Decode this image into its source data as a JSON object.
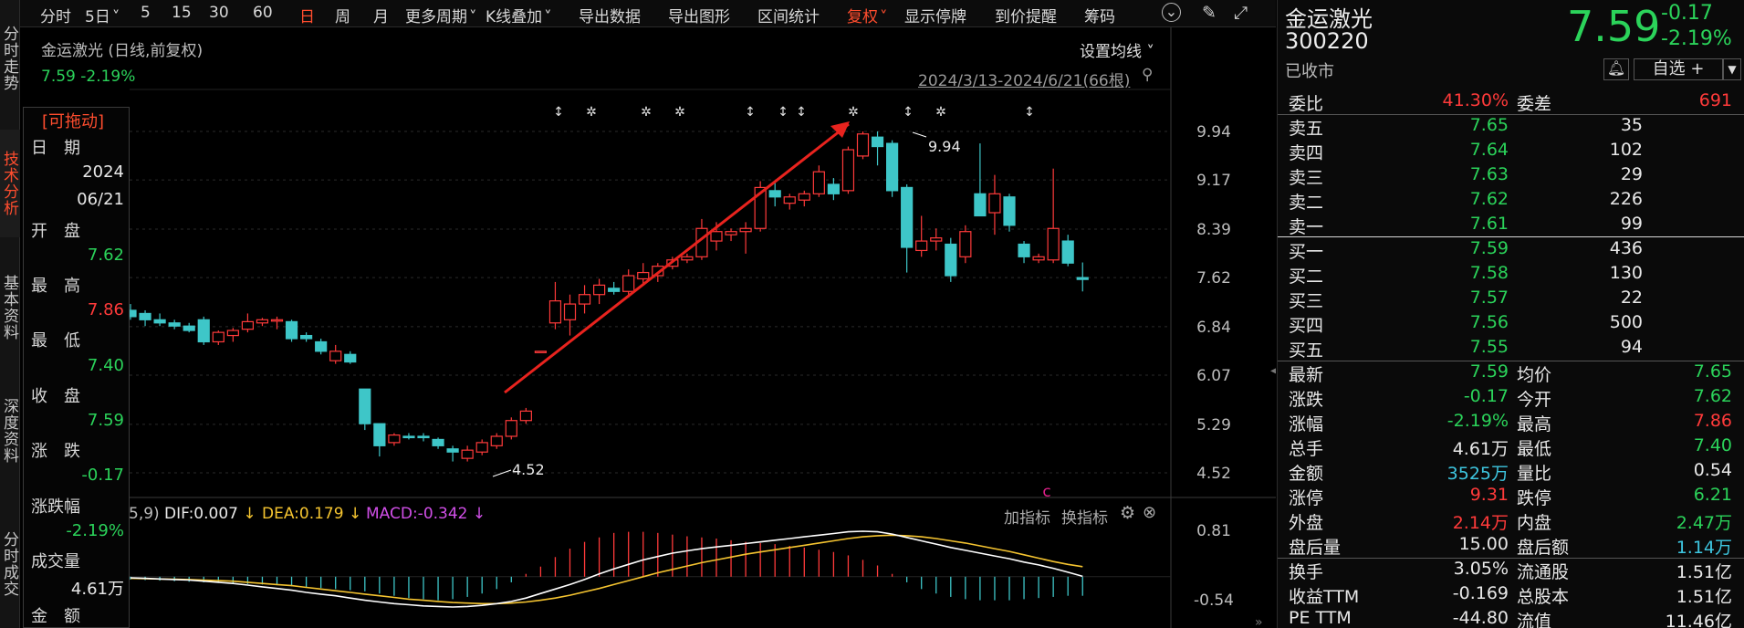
{
  "left_nav": [
    {
      "label": "分时走势",
      "active": false
    },
    {
      "label": "技术分析",
      "active": true
    },
    {
      "label": "基本资料",
      "active": false
    },
    {
      "label": "深度资料",
      "active": false
    },
    {
      "label": "分时成交",
      "active": false
    }
  ],
  "toolbar": {
    "items": [
      "分时",
      "5日",
      "5",
      "15",
      "30",
      "60",
      "日",
      "周",
      "月",
      "更多周期",
      "K线叠加",
      "导出数据",
      "导出图形",
      "区间统计",
      "复权",
      "显示停牌",
      "到价提醒",
      "筹码"
    ],
    "active": "日",
    "highlight": "复权"
  },
  "chart": {
    "title": "金运激光 (日线,前复权)",
    "price_change": "7.59 -2.19%",
    "ma_settings": "设置均线",
    "date_range": "2024/3/13-2024/6/21(66根)",
    "y_labels": [
      "9.94",
      "9.17",
      "8.39",
      "7.62",
      "6.84",
      "6.07",
      "5.29",
      "4.52"
    ],
    "high_label": "9.94",
    "low_label": "4.52",
    "marker": "c"
  },
  "info_panel": {
    "title": "[可拖动]",
    "rows": [
      {
        "label": "日　期",
        "value": ""
      },
      {
        "label": "",
        "value": "2024"
      },
      {
        "label": "",
        "value": "06/21"
      },
      {
        "label": "开　盘",
        "value": ""
      },
      {
        "label": "",
        "value": "7.62"
      },
      {
        "label": "最　高",
        "value": ""
      },
      {
        "label": "",
        "value": "7.86"
      },
      {
        "label": "最　低",
        "value": ""
      },
      {
        "label": "",
        "value": "7.40"
      },
      {
        "label": "收　盘",
        "value": ""
      },
      {
        "label": "",
        "value": "7.59"
      },
      {
        "label": "涨　跌",
        "value": ""
      },
      {
        "label": "",
        "value": "-0.17"
      },
      {
        "label": "涨跌幅",
        "value": ""
      },
      {
        "label": "",
        "value": "-2.19%"
      },
      {
        "label": "成交量",
        "value": ""
      },
      {
        "label": "",
        "value": "4.61万"
      },
      {
        "label": "金　额",
        "value": ""
      }
    ]
  },
  "macd": {
    "params": "5,9)",
    "dif": "DIF:0.007",
    "dea": "DEA:0.179",
    "macd": "MACD:-0.342",
    "add_indicator": "加指标",
    "switch_indicator": "换指标",
    "y_top": "0.81",
    "y_bottom": "-0.54"
  },
  "quote": {
    "name": "金运激光",
    "code": "300220",
    "status": "已收市",
    "price": "7.59",
    "change": "-0.17",
    "change_pct": "-2.19%",
    "watchlist_btn": "自选 +",
    "weibi_label": "委比",
    "weibi": "41.30%",
    "weicha_label": "委差",
    "weicha": "691",
    "asks": [
      {
        "label": "卖五",
        "price": "7.65",
        "vol": "35"
      },
      {
        "label": "卖四",
        "price": "7.64",
        "vol": "102"
      },
      {
        "label": "卖三",
        "price": "7.63",
        "vol": "29"
      },
      {
        "label": "卖二",
        "price": "7.62",
        "vol": "226"
      },
      {
        "label": "卖一",
        "price": "7.61",
        "vol": "99"
      }
    ],
    "bids": [
      {
        "label": "买一",
        "price": "7.59",
        "vol": "436"
      },
      {
        "label": "买二",
        "price": "7.58",
        "vol": "130"
      },
      {
        "label": "买三",
        "price": "7.57",
        "vol": "22"
      },
      {
        "label": "买四",
        "price": "7.56",
        "vol": "500"
      },
      {
        "label": "买五",
        "price": "7.55",
        "vol": "94"
      }
    ],
    "stats": [
      {
        "l1": "最新",
        "v1": "7.59",
        "c1": "green",
        "l2": "均价",
        "v2": "7.65",
        "c2": "green"
      },
      {
        "l1": "涨跌",
        "v1": "-0.17",
        "c1": "green",
        "l2": "今开",
        "v2": "7.62",
        "c2": "green"
      },
      {
        "l1": "涨幅",
        "v1": "-2.19%",
        "c1": "green",
        "l2": "最高",
        "v2": "7.86",
        "c2": "red"
      },
      {
        "l1": "总手",
        "v1": "4.61万",
        "c1": "white",
        "l2": "最低",
        "v2": "7.40",
        "c2": "green"
      },
      {
        "l1": "金额",
        "v1": "3525万",
        "c1": "cyan",
        "l2": "量比",
        "v2": "0.54",
        "c2": "white"
      },
      {
        "l1": "涨停",
        "v1": "9.31",
        "c1": "red",
        "l2": "跌停",
        "v2": "6.21",
        "c2": "green"
      },
      {
        "l1": "外盘",
        "v1": "2.14万",
        "c1": "red",
        "l2": "内盘",
        "v2": "2.47万",
        "c2": "green"
      },
      {
        "l1": "盘后量",
        "v1": "15.00",
        "c1": "white",
        "l2": "盘后额",
        "v2": "1.14万",
        "c2": "cyan"
      },
      {
        "l1": "换手",
        "v1": "3.05%",
        "c1": "white",
        "l2": "流通股",
        "v2": "1.51亿",
        "c2": "white"
      },
      {
        "l1": "收益TTM",
        "v1": "-0.169",
        "c1": "white",
        "l2": "总股本",
        "v2": "1.51亿",
        "c2": "white"
      },
      {
        "l1": "PE TTM",
        "v1": "-44.80",
        "c1": "white",
        "l2": "流值",
        "v2": "11.46亿",
        "c2": "white"
      }
    ]
  },
  "chart_data": {
    "type": "candlestick",
    "ylim": [
      4.52,
      9.94
    ],
    "candles": [
      [
        7.1,
        7.2,
        6.95,
        7.0
      ],
      [
        7.05,
        7.1,
        6.85,
        6.95
      ],
      [
        6.95,
        7.05,
        6.85,
        6.9
      ],
      [
        6.9,
        6.95,
        6.8,
        6.85
      ],
      [
        6.85,
        6.9,
        6.75,
        6.78
      ],
      [
        6.95,
        7.0,
        6.55,
        6.6
      ],
      [
        6.6,
        6.78,
        6.55,
        6.75
      ],
      [
        6.7,
        6.82,
        6.6,
        6.78
      ],
      [
        6.8,
        7.05,
        6.75,
        6.92
      ],
      [
        6.9,
        6.98,
        6.85,
        6.95
      ],
      [
        6.95,
        7.0,
        6.8,
        6.95
      ],
      [
        6.92,
        6.95,
        6.6,
        6.65
      ],
      [
        6.7,
        6.75,
        6.6,
        6.65
      ],
      [
        6.6,
        6.65,
        6.4,
        6.45
      ],
      [
        6.3,
        6.55,
        6.25,
        6.45
      ],
      [
        6.4,
        6.45,
        6.25,
        6.28
      ],
      [
        5.85,
        5.85,
        5.2,
        5.3
      ],
      [
        5.3,
        5.3,
        4.78,
        4.95
      ],
      [
        5.0,
        5.15,
        4.95,
        5.12
      ],
      [
        5.1,
        5.15,
        5.05,
        5.08
      ],
      [
        5.1,
        5.15,
        5.02,
        5.08
      ],
      [
        5.05,
        5.08,
        4.9,
        4.95
      ],
      [
        4.9,
        4.95,
        4.7,
        4.85
      ],
      [
        4.75,
        4.95,
        4.7,
        4.88
      ],
      [
        4.85,
        5.05,
        4.8,
        5.0
      ],
      [
        4.95,
        5.15,
        4.9,
        5.1
      ],
      [
        5.1,
        5.4,
        5.05,
        5.35
      ],
      [
        5.35,
        5.55,
        5.3,
        5.5
      ],
      [
        6.45,
        6.45,
        6.45,
        6.45
      ],
      [
        6.9,
        7.55,
        6.8,
        7.25
      ],
      [
        6.95,
        7.35,
        6.7,
        7.2
      ],
      [
        7.2,
        7.5,
        7.05,
        7.35
      ],
      [
        7.35,
        7.6,
        7.2,
        7.5
      ],
      [
        7.45,
        7.55,
        7.35,
        7.4
      ],
      [
        7.4,
        7.75,
        7.3,
        7.65
      ],
      [
        7.6,
        7.85,
        7.5,
        7.7
      ],
      [
        7.65,
        7.85,
        7.55,
        7.8
      ],
      [
        7.8,
        7.95,
        7.75,
        7.9
      ],
      [
        7.9,
        8.0,
        7.85,
        7.95
      ],
      [
        7.95,
        8.55,
        7.9,
        8.4
      ],
      [
        8.2,
        8.5,
        8.05,
        8.35
      ],
      [
        8.3,
        8.4,
        8.2,
        8.35
      ],
      [
        8.35,
        8.5,
        8.0,
        8.4
      ],
      [
        8.4,
        9.15,
        8.35,
        9.05
      ],
      [
        9.0,
        9.15,
        8.75,
        8.9
      ],
      [
        8.8,
        8.95,
        8.7,
        8.9
      ],
      [
        8.85,
        9.0,
        8.75,
        8.95
      ],
      [
        8.95,
        9.4,
        8.9,
        9.3
      ],
      [
        9.1,
        9.2,
        8.85,
        8.95
      ],
      [
        9.0,
        9.7,
        8.95,
        9.65
      ],
      [
        9.55,
        9.94,
        9.5,
        9.9
      ],
      [
        9.85,
        9.94,
        9.4,
        9.7
      ],
      [
        9.75,
        9.8,
        8.9,
        9.0
      ],
      [
        9.05,
        9.1,
        7.7,
        8.1
      ],
      [
        8.05,
        8.6,
        7.95,
        8.2
      ],
      [
        8.2,
        8.4,
        8.05,
        8.25
      ],
      [
        8.15,
        8.25,
        7.55,
        7.65
      ],
      [
        7.95,
        8.45,
        7.85,
        8.35
      ],
      [
        8.95,
        9.75,
        8.6,
        8.6
      ],
      [
        8.65,
        9.25,
        8.3,
        8.95
      ],
      [
        8.9,
        8.95,
        8.35,
        8.45
      ],
      [
        8.15,
        8.2,
        7.85,
        7.95
      ],
      [
        7.9,
        8.0,
        7.85,
        7.95
      ],
      [
        7.9,
        9.35,
        7.85,
        8.4
      ],
      [
        8.2,
        8.3,
        7.8,
        7.85
      ],
      [
        7.62,
        7.86,
        7.4,
        7.59
      ]
    ],
    "macd_hist": [
      -0.05,
      -0.06,
      -0.07,
      -0.08,
      -0.09,
      -0.1,
      -0.11,
      -0.12,
      -0.13,
      -0.14,
      -0.15,
      -0.17,
      -0.19,
      -0.2,
      -0.22,
      -0.24,
      -0.26,
      -0.3,
      -0.34,
      -0.38,
      -0.4,
      -0.42,
      -0.4,
      -0.36,
      -0.3,
      -0.22,
      -0.1,
      0.05,
      0.18,
      0.35,
      0.5,
      0.62,
      0.7,
      0.78,
      0.8,
      0.8,
      0.78,
      0.75,
      0.72,
      0.7,
      0.68,
      0.65,
      0.62,
      0.6,
      0.58,
      0.55,
      0.52,
      0.48,
      0.44,
      0.38,
      0.3,
      0.2,
      0.05,
      -0.1,
      -0.22,
      -0.3,
      -0.36,
      -0.4,
      -0.42,
      -0.42,
      -0.42,
      -0.4,
      -0.38,
      -0.36,
      -0.34,
      -0.34
    ],
    "dif": [
      -0.02,
      -0.03,
      -0.04,
      -0.05,
      -0.06,
      -0.08,
      -0.1,
      -0.12,
      -0.15,
      -0.18,
      -0.21,
      -0.24,
      -0.28,
      -0.31,
      -0.34,
      -0.38,
      -0.42,
      -0.45,
      -0.48,
      -0.5,
      -0.52,
      -0.53,
      -0.54,
      -0.53,
      -0.51,
      -0.48,
      -0.44,
      -0.38,
      -0.3,
      -0.22,
      -0.14,
      -0.05,
      0.05,
      0.14,
      0.22,
      0.3,
      0.36,
      0.42,
      0.46,
      0.5,
      0.53,
      0.56,
      0.59,
      0.62,
      0.65,
      0.68,
      0.71,
      0.74,
      0.77,
      0.8,
      0.81,
      0.8,
      0.76,
      0.7,
      0.64,
      0.58,
      0.52,
      0.47,
      0.42,
      0.37,
      0.32,
      0.26,
      0.21,
      0.15,
      0.08,
      0.007
    ],
    "dea": [
      -0.03,
      -0.035,
      -0.04,
      -0.045,
      -0.05,
      -0.06,
      -0.07,
      -0.08,
      -0.1,
      -0.12,
      -0.14,
      -0.16,
      -0.19,
      -0.22,
      -0.25,
      -0.28,
      -0.31,
      -0.34,
      -0.37,
      -0.4,
      -0.42,
      -0.44,
      -0.46,
      -0.47,
      -0.48,
      -0.48,
      -0.47,
      -0.45,
      -0.42,
      -0.38,
      -0.33,
      -0.27,
      -0.21,
      -0.14,
      -0.07,
      0.0,
      0.07,
      0.13,
      0.19,
      0.25,
      0.3,
      0.35,
      0.4,
      0.44,
      0.48,
      0.52,
      0.56,
      0.6,
      0.64,
      0.68,
      0.71,
      0.73,
      0.74,
      0.73,
      0.71,
      0.68,
      0.64,
      0.6,
      0.55,
      0.5,
      0.45,
      0.39,
      0.33,
      0.27,
      0.22,
      0.179
    ]
  }
}
